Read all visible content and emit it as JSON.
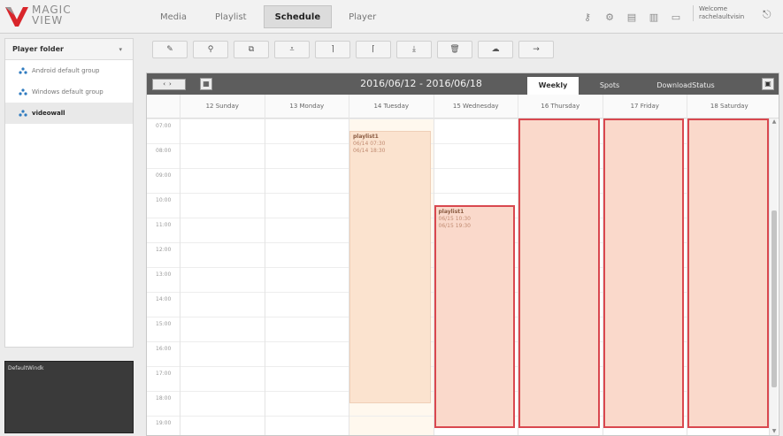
{
  "app": {
    "logo_text_top": "MAGIC",
    "logo_text_bottom": "VIEW",
    "brand_color": "#d9262b"
  },
  "nav": {
    "tabs": [
      {
        "label": "Media"
      },
      {
        "label": "Playlist"
      },
      {
        "label": "Schedule",
        "active": true
      },
      {
        "label": "Player"
      }
    ]
  },
  "header": {
    "icons": [
      "key-icon",
      "gear-icon",
      "clipboard-icon",
      "bar-chart-icon",
      "monitor-icon"
    ],
    "welcome_label": "Welcome",
    "user": "rachelaultvisin",
    "logout_icon": "logout-icon"
  },
  "sidebar": {
    "title": "Player folder",
    "items": [
      {
        "label": "Android default group",
        "selected": false
      },
      {
        "label": "Windows default group",
        "selected": false
      },
      {
        "label": "videowall",
        "selected": true
      }
    ],
    "preview_label": "DefaultWindk"
  },
  "toolbar": {
    "buttons": [
      {
        "icon": "pencil-icon",
        "glyph": "✎"
      },
      {
        "icon": "search-icon",
        "glyph": "⚲"
      },
      {
        "icon": "copy-icon",
        "glyph": "⧉"
      },
      {
        "icon": "align-bottom-icon",
        "glyph": "⩡"
      },
      {
        "icon": "bracket-right-icon",
        "glyph": "⌉"
      },
      {
        "icon": "bracket-left-icon",
        "glyph": "⌈"
      },
      {
        "icon": "arrow-down-icon",
        "glyph": "⤓"
      },
      {
        "icon": "trash-icon",
        "glyph": "🗑"
      },
      {
        "icon": "cloud-icon",
        "glyph": "☁"
      },
      {
        "icon": "arrow-right-icon",
        "glyph": "→"
      }
    ]
  },
  "schedule": {
    "date_range": "2016/06/12 - 2016/06/18",
    "nav_prev": "‹",
    "nav_next": "›",
    "tabs": [
      {
        "label": "Weekly",
        "active": true
      },
      {
        "label": "Spots",
        "active": false
      },
      {
        "label": "DownloadStatus",
        "active": false
      }
    ],
    "days": [
      "12 Sunday",
      "13 Monday",
      "14 Tuesday",
      "15 Wednesday",
      "16 Thursday",
      "17 Friday",
      "18 Saturday"
    ],
    "hours": [
      "07:00",
      "08:00",
      "09:00",
      "10:00",
      "11:00",
      "12:00",
      "13:00",
      "14:00",
      "15:00",
      "16:00",
      "17:00",
      "18:00",
      "19:00"
    ],
    "events": [
      {
        "day": 2,
        "start": 7.5,
        "end": 18.5,
        "title": "playlist1",
        "line1": "06/14 07:30",
        "line2": "06/14 18:30",
        "selected": false
      },
      {
        "day": 3,
        "start": 10.5,
        "end": 19.5,
        "title": "playlist1",
        "line1": "06/15 10:30",
        "line2": "06/15 19:30",
        "selected": true
      },
      {
        "day": 4,
        "start": 7.0,
        "end": 19.5,
        "title": "",
        "line1": "",
        "line2": "",
        "selected": true
      },
      {
        "day": 5,
        "start": 7.0,
        "end": 19.5,
        "title": "",
        "line1": "",
        "line2": "",
        "selected": true
      },
      {
        "day": 6,
        "start": 7.0,
        "end": 19.5,
        "title": "",
        "line1": "",
        "line2": "",
        "selected": true
      }
    ]
  }
}
